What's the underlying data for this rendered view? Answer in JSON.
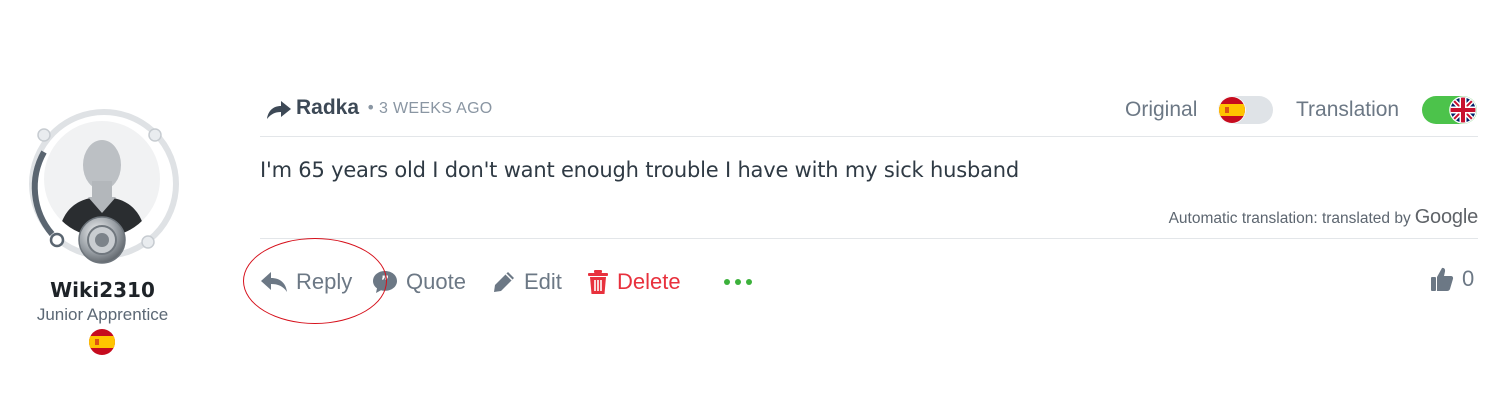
{
  "author": {
    "username": "Wiki2310",
    "rank": "Junior Apprentice",
    "flag_icon": "spain-flag-icon"
  },
  "post": {
    "reply_to_author": "Radka",
    "separator": "•",
    "time_ago": "3 WEEKS AGO",
    "body": "I'm 65 years old I don't want enough trouble I have with my sick husband",
    "translation_note": "Automatic translation: translated by",
    "translation_brand": "Google"
  },
  "language_toggle": {
    "original_label": "Original",
    "original_flag": "spain-flag-icon",
    "original_on": false,
    "translation_label": "Translation",
    "translation_flag": "uk-flag-icon",
    "translation_on": true
  },
  "actions": {
    "reply": "Reply",
    "quote": "Quote",
    "edit": "Edit",
    "delete": "Delete",
    "more_icon": "more-dots-icon"
  },
  "likes": {
    "count": "0",
    "icon": "thumbs-up-icon"
  },
  "colors": {
    "delete": "#e8313d",
    "toggle_on": "#4cc34b",
    "more_dots": "#3cb13b",
    "annotation": "#d6101b"
  }
}
